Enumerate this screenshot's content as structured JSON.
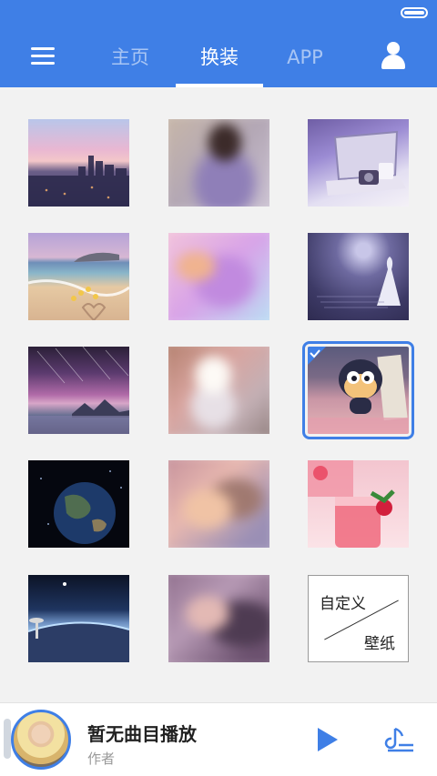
{
  "header": {
    "tabs": [
      {
        "label": "主页",
        "active": false
      },
      {
        "label": "换装",
        "active": true
      },
      {
        "label": "APP",
        "active": false
      }
    ],
    "accent_color": "#3f7fe6"
  },
  "wallpapers": [
    {
      "name": "city-skyline-sunset",
      "blurred": false
    },
    {
      "name": "woman-portrait",
      "blurred": true
    },
    {
      "name": "laptop-camera-desk",
      "blurred": false
    },
    {
      "name": "beach-hearts",
      "blurred": false
    },
    {
      "name": "woman-lying-pink",
      "blurred": true
    },
    {
      "name": "girl-in-white-dress-night",
      "blurred": false
    },
    {
      "name": "starry-mountain-lake",
      "blurred": false
    },
    {
      "name": "girl-street",
      "blurred": true
    },
    {
      "name": "cartoon-character-shopping-bag",
      "blurred": false,
      "selected": true
    },
    {
      "name": "earth-space",
      "blurred": false
    },
    {
      "name": "couple-closeup",
      "blurred": true
    },
    {
      "name": "strawberry-drinks",
      "blurred": false
    },
    {
      "name": "earth-horizon",
      "blurred": false
    },
    {
      "name": "woman-blurred",
      "blurred": true
    }
  ],
  "custom_wallpaper": {
    "line1": "自定义",
    "line2": "壁纸"
  },
  "player": {
    "title": "暂无曲目播放",
    "author": "作者"
  }
}
